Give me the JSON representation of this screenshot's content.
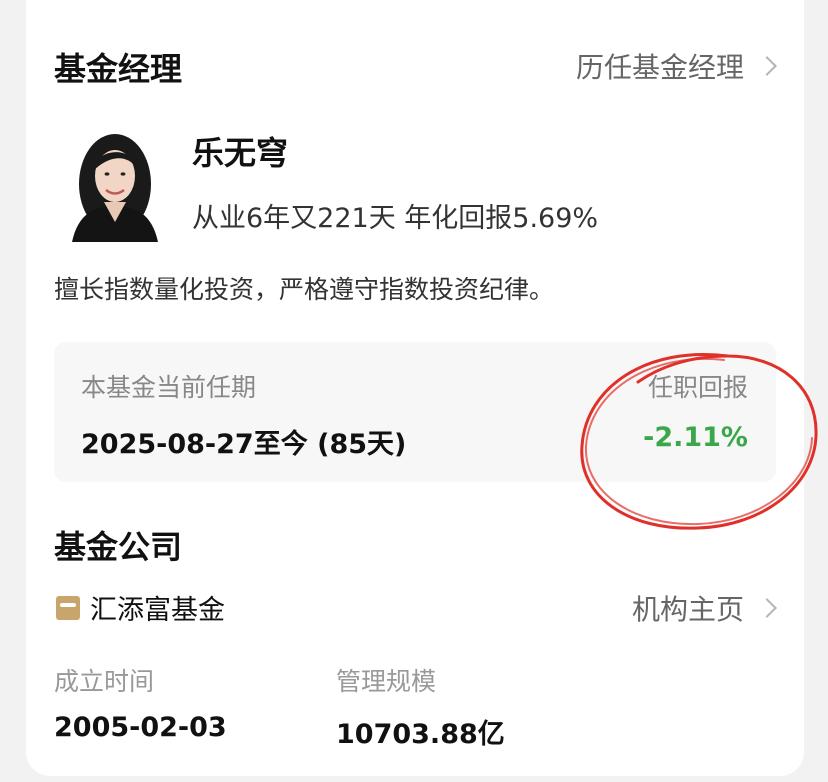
{
  "manager_section": {
    "title": "基金经理",
    "history_link": "历任基金经理"
  },
  "manager": {
    "name": "乐无穹",
    "experience": "从业6年又221天 年化回报5.69%",
    "description": "擅长指数量化投资，严格遵守指数投资纪律。"
  },
  "tenure": {
    "label": "本基金当前任期",
    "value": "2025-08-27至今 (85天)",
    "return_label": "任职回报",
    "return_value": "-2.11%"
  },
  "company_section": {
    "title": "基金公司",
    "company_name": "汇添富基金",
    "homepage_link": "机构主页",
    "founded_label": "成立时间",
    "founded_value": "2005-02-03",
    "aum_label": "管理规模",
    "aum_value": "10703.88亿"
  },
  "colors": {
    "positive_green": "#3aa84a",
    "annotation_red": "#e0302a",
    "logo_gold": "#c7a56b"
  }
}
